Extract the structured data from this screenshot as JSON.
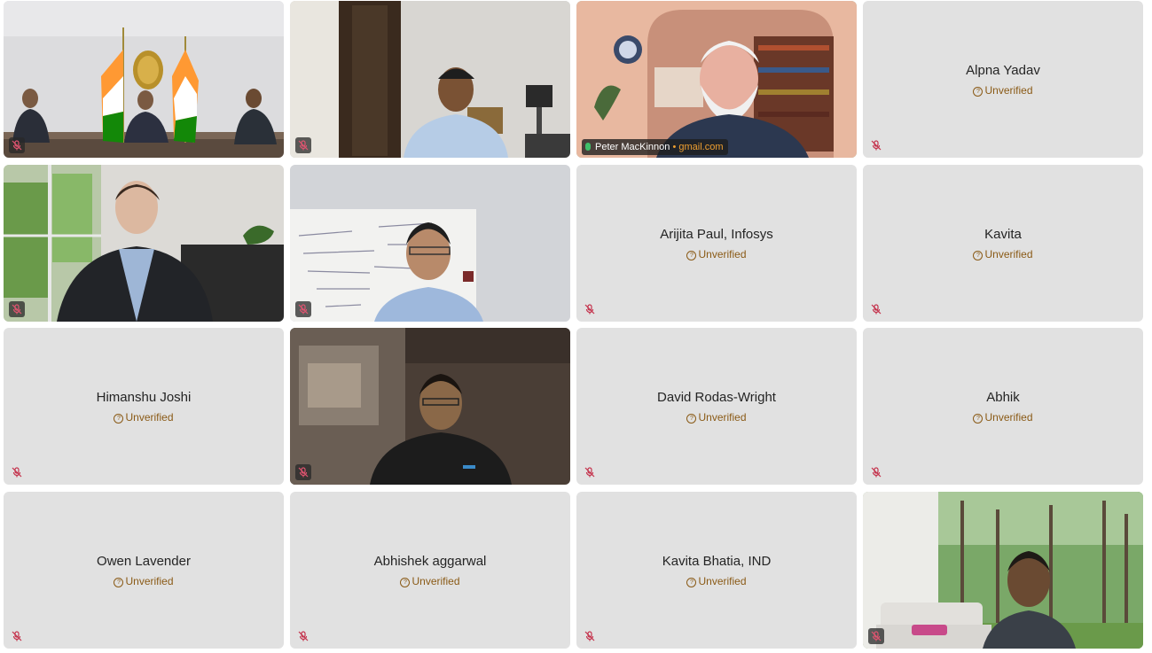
{
  "unverified_label": "Unverified",
  "participants": {
    "p_room": {
      "name": ""
    },
    "p_office": {
      "name": ""
    },
    "p_peter": {
      "name": "Peter MacKinnon",
      "domain_sep": " • ",
      "domain": "gmail.com"
    },
    "p_alpna": {
      "name": "Alpna Yadav",
      "status": "Unverified"
    },
    "p_suit": {
      "name": ""
    },
    "p_whiteboard": {
      "name": ""
    },
    "p_arijita": {
      "name": "Arijita Paul, Infosys",
      "status": "Unverified"
    },
    "p_kavita": {
      "name": "Kavita",
      "status": "Unverified"
    },
    "p_himanshu": {
      "name": "Himanshu Joshi",
      "status": "Unverified"
    },
    "p_dark": {
      "name": ""
    },
    "p_david": {
      "name": "David Rodas-Wright",
      "status": "Unverified"
    },
    "p_abhik": {
      "name": "Abhik",
      "status": "Unverified"
    },
    "p_owen": {
      "name": "Owen Lavender",
      "status": "Unverified"
    },
    "p_abhishek": {
      "name": "Abhishek aggarwal",
      "status": "Unverified"
    },
    "p_kavitab": {
      "name": "Kavita Bhatia, IND",
      "status": "Unverified"
    },
    "p_forest": {
      "name": ""
    }
  },
  "colors": {
    "tile_bg": "#e1e1e1",
    "unverified": "#8a5a16",
    "muted_mic": "#c4314b",
    "active_border": "#8ee0cf",
    "domain": "#f0a030"
  },
  "icons": {
    "muted": "mic-off-icon",
    "unverified": "question-circle-icon",
    "speaking": "mic-icon"
  }
}
